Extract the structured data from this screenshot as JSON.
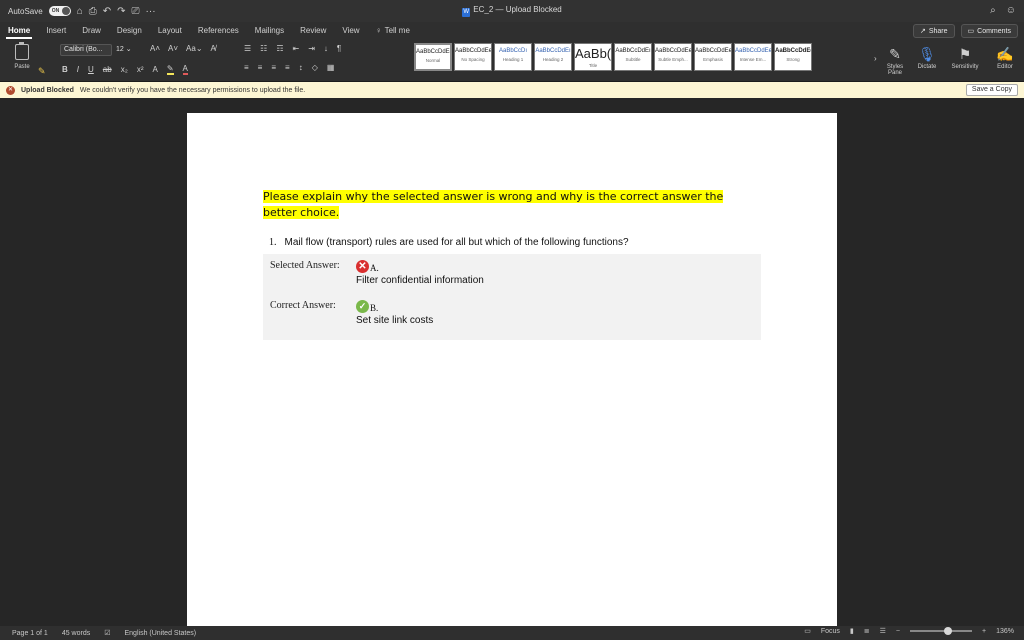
{
  "titlebar": {
    "autosave_label": "AutoSave",
    "autosave_state": "ON",
    "doc_title": "EC_2 — Upload Blocked",
    "doc_icon": "W"
  },
  "tabs": [
    "Home",
    "Insert",
    "Draw",
    "Design",
    "Layout",
    "References",
    "Mailings",
    "Review",
    "View"
  ],
  "tell_me": "Tell me",
  "share_label": "Share",
  "comments_label": "Comments",
  "ribbon": {
    "paste_label": "Paste",
    "font_name": "Calibri (Bo...",
    "font_size": "12",
    "styles": [
      {
        "sample": "AaBbCcDdEe",
        "name": "Normal"
      },
      {
        "sample": "AaBbCcDdEe",
        "name": "No Spacing"
      },
      {
        "sample": "AaBbCcDı",
        "name": "Heading 1"
      },
      {
        "sample": "AaBbCcDdEı",
        "name": "Heading 2"
      },
      {
        "sample": "AaBb(",
        "name": "Title"
      },
      {
        "sample": "AaBbCcDdEı",
        "name": "Subtitle"
      },
      {
        "sample": "AaBbCcDdEe",
        "name": "Subtle Emph..."
      },
      {
        "sample": "AaBbCcDdEe",
        "name": "Emphasis"
      },
      {
        "sample": "AaBbCcDdEe",
        "name": "Intense Em..."
      },
      {
        "sample": "AaBbCcDdEe",
        "name": "Strong"
      }
    ],
    "styles_pane_label": "Styles Pane",
    "dictate_label": "Dictate",
    "sensitivity_label": "Sensitivity",
    "editor_label": "Editor"
  },
  "message_bar": {
    "title": "Upload Blocked",
    "text": "We couldn't verify you have the necessary permissions to upload the file.",
    "button": "Save a Copy"
  },
  "document": {
    "prompt": "Please explain why the selected answer is wrong and why is the correct answer the better choice.",
    "question_number": "1.",
    "question_text": "Mail flow (transport) rules are used for all but which of the following functions?",
    "selected_label": "Selected Answer:",
    "selected_letter": "A.",
    "selected_text": "Filter confidential information",
    "correct_label": "Correct Answer:",
    "correct_letter": "B.",
    "correct_text": "Set site link costs"
  },
  "statusbar": {
    "page": "Page 1 of 1",
    "words": "45 words",
    "language": "English (United States)",
    "focus": "Focus",
    "zoom": "136%"
  }
}
